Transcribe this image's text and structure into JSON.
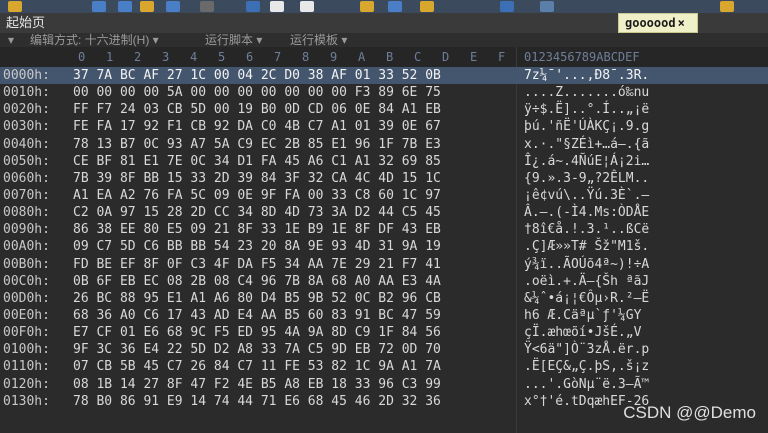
{
  "toolbar": {
    "icons": [
      "save-icon",
      "save-all-icon",
      "print-icon",
      "folder-icon",
      "copy-icon",
      "cut-icon",
      "paste-icon",
      "undo-icon",
      "redo-icon",
      "find-icon",
      "replace-icon",
      "goto-icon",
      "hex-icon",
      "columns-icon",
      "settings-icon"
    ]
  },
  "tabs": {
    "start": "起始页",
    "file": "goooood",
    "close": "×"
  },
  "options": {
    "collapse": "▾",
    "edit_mode": "编辑方式: 十六进制(H) ▾",
    "run_script": "运行脚本 ▾",
    "run_template": "运行模板 ▾"
  },
  "header": {
    "columns": [
      "0",
      "1",
      "2",
      "3",
      "4",
      "5",
      "6",
      "7",
      "8",
      "9",
      "A",
      "B",
      "C",
      "D",
      "E",
      "F"
    ],
    "ascii": "0123456789ABCDEF"
  },
  "rows": [
    {
      "offset": "0000h:",
      "hex": "37 7A BC AF 27 1C 00 04 2C D0 38 AF 01 33 52 0B",
      "ascii": "7z¼¯'...,Ð8¯.3R."
    },
    {
      "offset": "0010h:",
      "hex": "00 00 00 00 5A 00 00 00 00 00 00 00 F3 89 6E 75",
      "ascii": "....Z.......ó‰nu"
    },
    {
      "offset": "0020h:",
      "hex": "FF F7 24 03 CB 5D 00 19 B0 0D CD 06 0E 84 A1 EB",
      "ascii": "ÿ÷$.Ë]..°.Í..„¡ë"
    },
    {
      "offset": "0030h:",
      "hex": "FE FA 17 92 F1 CB 92 DA C0 4B C7 A1 01 39 0E 67",
      "ascii": "þú.'ñË'ÚÀKÇ¡.9.g"
    },
    {
      "offset": "0040h:",
      "hex": "78 13 B7 0C 93 A7 5A C9 EC 2B 85 E1 96 1F 7B E3",
      "ascii": "x.·.\"§ZÉì+…á–.{ã"
    },
    {
      "offset": "0050h:",
      "hex": "CE BF 81 E1 7E 0C 34 D1 FA 45 A6 C1 A1 32 69 85",
      "ascii": "Î¿.á~.4ÑúE¦Á¡2i…"
    },
    {
      "offset": "0060h:",
      "hex": "7B 39 8F BB 15 33 2D 39 84 3F 32 CA 4C 4D 15 1C",
      "ascii": "{9.».3-9„?2ÊLM.."
    },
    {
      "offset": "0070h:",
      "hex": "A1 EA A2 76 FA 5C 09 0E 9F FA 00 33 C8 60 1C 97",
      "ascii": "¡ê¢vú\\..Ÿú.3È`.—"
    },
    {
      "offset": "0080h:",
      "hex": "C2 0A 97 15 28 2D CC 34 8D 4D 73 3A D2 44 C5 45",
      "ascii": "Â.—.(-Ì4.Ms:ÒDÅE"
    },
    {
      "offset": "0090h:",
      "hex": "86 38 EE 80 E5 09 21 8F 33 1E B9 1E 8F DF 43 EB",
      "ascii": "†8î€å.!.3.¹..ßCë"
    },
    {
      "offset": "00A0h:",
      "hex": "09 C7 5D C6 BB BB 54 23 20 8A 9E 93 4D 31 9A 19",
      "ascii": ".Ç]Æ»»T# Šž\"M1š."
    },
    {
      "offset": "00B0h:",
      "hex": "FD BE EF 8F 0F C3 4F DA F5 34 AA 7E 29 21 F7 41",
      "ascii": "ý¾ï..ÃOÚõ4ª~)!÷A"
    },
    {
      "offset": "00C0h:",
      "hex": "0B 6F EB EC 08 2B 08 C4 96 7B 8A 68 A0 AA E3 4A",
      "ascii": ".oëì.+.Ä–{Šh ªãJ"
    },
    {
      "offset": "00D0h:",
      "hex": "26 BC 88 95 E1 A1 A6 80 D4 B5 9B 52 0C B2 96 CB",
      "ascii": "&¼ˆ•á¡¦€Ôµ›R.²–Ë"
    },
    {
      "offset": "00E0h:",
      "hex": "68 36 A0 C6 17 43 AD E4 AA B5 60 83 91 BC 47 59",
      "ascii": "h6 Æ.C­äªµ`ƒ'¼GY"
    },
    {
      "offset": "00F0h:",
      "hex": "E7 CF 01 E6 68 9C F5 ED 95 4A 9A 8D C9 1F 84 56",
      "ascii": "çÏ.æhœõí•JšÉ.„V"
    },
    {
      "offset": "0100h:",
      "hex": "9F 3C 36 E4 22 5D D2 A8 33 7A C5 9D EB 72 0D 70",
      "ascii": "Ÿ<6ä\"]Ò¨3zÅ.ër.p"
    },
    {
      "offset": "0110h:",
      "hex": "07 CB 5B 45 C7 26 84 C7 11 FE 53 82 1C 9A A1 7A",
      "ascii": ".Ë[EÇ&„Ç.þS‚.š¡z"
    },
    {
      "offset": "0120h:",
      "hex": "08 1B 14 27 8F 47 F2 4E B5 A8 EB 18 33 96 C3 99",
      "ascii": "...'.GòNµ¨ë.3–Ã™"
    },
    {
      "offset": "0130h:",
      "hex": "78 B0 86 91 E9 14 74 44 71 E6 68 45 46 2D 32 36",
      "ascii": "x°†'é.tDqæhEF-26"
    }
  ],
  "selected_row": 0,
  "watermark": "CSDN @@Demo",
  "colors": {
    "background": "#2b2b2b",
    "selection": "#44556e",
    "file_tab": "#f0f0c8",
    "header_text": "#6f7f9a"
  }
}
